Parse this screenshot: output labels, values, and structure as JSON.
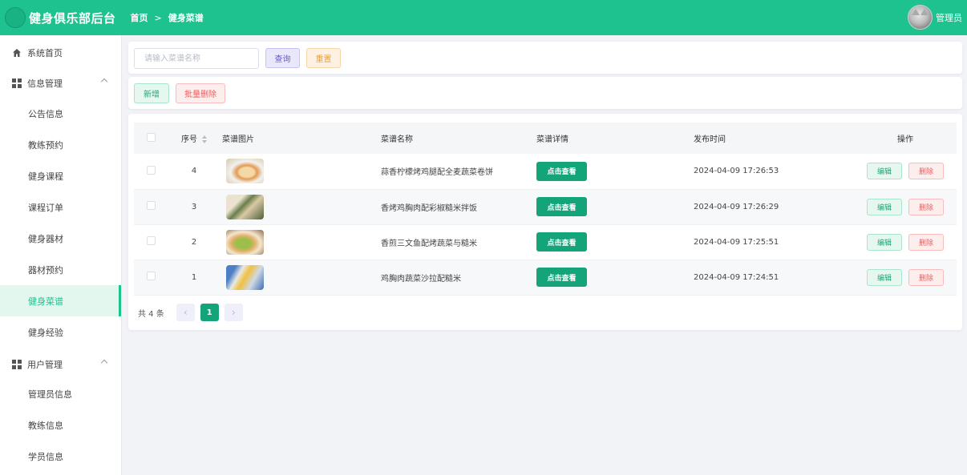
{
  "header": {
    "brand": "健身俱乐部后台",
    "breadcrumb": [
      "首页",
      "健身菜谱"
    ],
    "breadcrumb_sep": ">",
    "user_name": "管理员"
  },
  "sidebar": {
    "home": "系统首页",
    "info_group": "信息管理",
    "info_items": [
      "公告信息",
      "教练预约",
      "健身课程",
      "课程订单",
      "健身器材",
      "器材预约",
      "健身菜谱",
      "健身经验"
    ],
    "user_group": "用户管理",
    "user_items": [
      "管理员信息",
      "教练信息",
      "学员信息"
    ],
    "active": "健身菜谱"
  },
  "search": {
    "placeholder": "请输入菜谱名称",
    "query_label": "查询",
    "reset_label": "重置"
  },
  "toolbar": {
    "add_label": "新增",
    "batch_delete_label": "批量删除"
  },
  "table": {
    "columns": [
      "序号",
      "菜谱图片",
      "菜谱名称",
      "菜谱详情",
      "发布时间",
      "操作"
    ],
    "rows": [
      {
        "index": "4",
        "name": "蒜香柠檬烤鸡腿配全麦蔬菜卷饼",
        "detail": "点击查看",
        "time": "2024-04-09 17:26:53",
        "edit": "编辑",
        "delete": "删除"
      },
      {
        "index": "3",
        "name": "香烤鸡胸肉配彩椒糙米拌饭",
        "detail": "点击查看",
        "time": "2024-04-09 17:26:29",
        "edit": "编辑",
        "delete": "删除"
      },
      {
        "index": "2",
        "name": "香煎三文鱼配烤蔬菜与糙米",
        "detail": "点击查看",
        "time": "2024-04-09 17:25:51",
        "edit": "编辑",
        "delete": "删除"
      },
      {
        "index": "1",
        "name": "鸡胸肉蔬菜沙拉配糙米",
        "detail": "点击查看",
        "time": "2024-04-09 17:24:51",
        "edit": "编辑",
        "delete": "删除"
      }
    ]
  },
  "pager": {
    "total": "共 4 条",
    "prev": "‹",
    "current": "1",
    "next": "›"
  },
  "colors": {
    "brand": "#1ec28f",
    "primary_button": "#13a47a"
  }
}
